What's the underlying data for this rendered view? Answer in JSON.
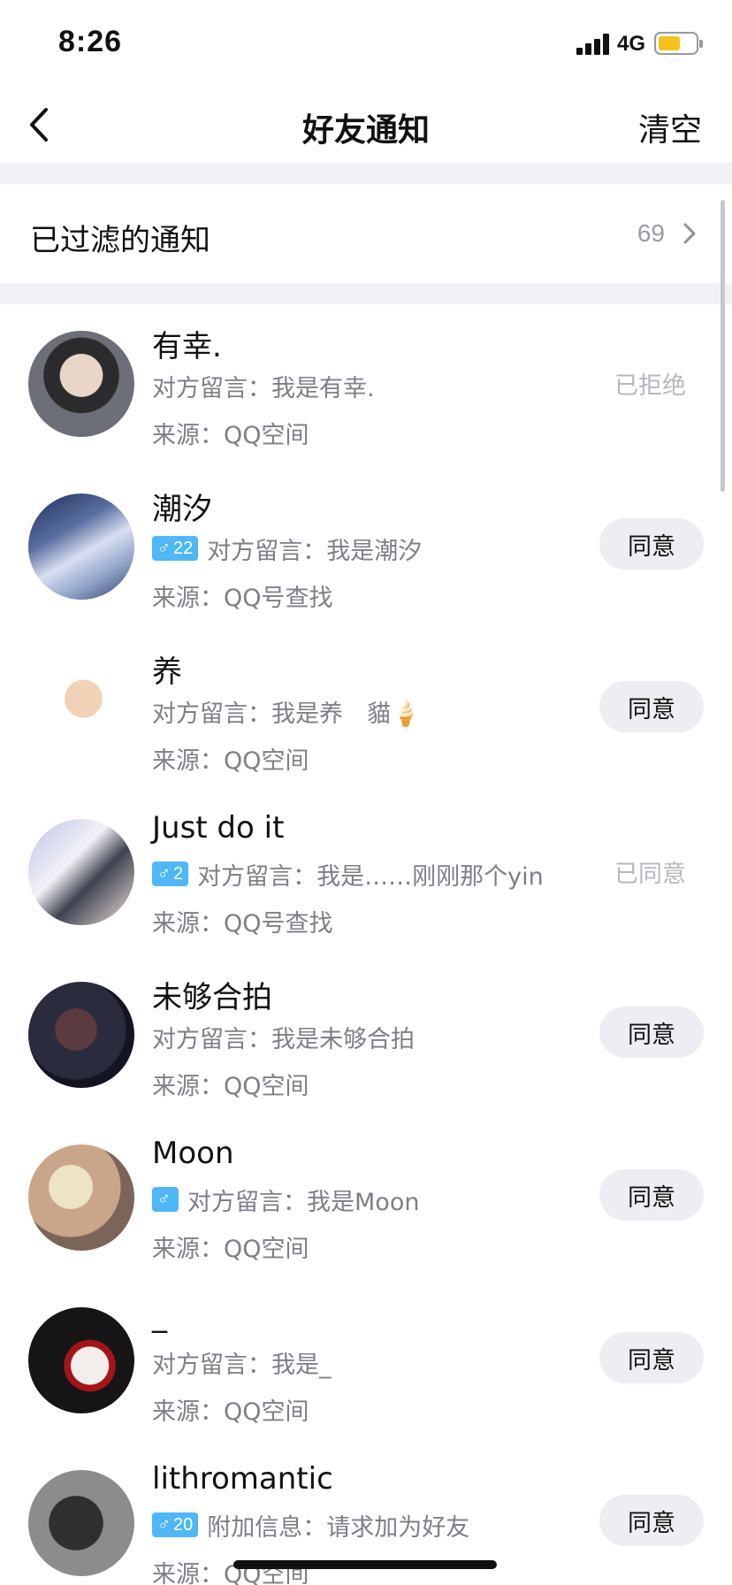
{
  "status_bar": {
    "time": "8:26",
    "network": "4G",
    "battery_color": "#f5c21b"
  },
  "nav": {
    "title": "好友通知",
    "clear_label": "清空",
    "back_icon": "chevron-left-icon"
  },
  "filtered": {
    "label": "已过滤的通知",
    "count": "69",
    "chevron_icon": "chevron-right-icon"
  },
  "colors": {
    "badge_male": "#4fb7f6",
    "secondary_text": "#7d7f88",
    "button_bg": "#edeef3",
    "gap_bg": "#f1f2f6"
  },
  "requests": [
    {
      "name": "有幸.",
      "badge": null,
      "message": "对方留言：我是有幸.",
      "source": "来源：QQ空间",
      "action": "已拒绝",
      "action_type": "status"
    },
    {
      "name": "潮汐",
      "badge": "22",
      "message": "对方留言：我是潮汐",
      "source": "来源：QQ号查找",
      "action": "同意",
      "action_type": "button"
    },
    {
      "name": "养",
      "badge": null,
      "message": "对方留言：我是养　貓🍦",
      "source": "来源：QQ空间",
      "action": "同意",
      "action_type": "button"
    },
    {
      "name": "Just do it",
      "badge": "2",
      "message": "对方留言：我是……刚刚那个yin",
      "source": "来源：QQ号查找",
      "action": "已同意",
      "action_type": "status"
    },
    {
      "name": "未够合拍",
      "badge": null,
      "message": "对方留言：我是未够合拍",
      "source": "来源：QQ空间",
      "action": "同意",
      "action_type": "button"
    },
    {
      "name": "Moon",
      "badge": "",
      "message": "对方留言：我是Moon",
      "source": "来源：QQ空间",
      "action": "同意",
      "action_type": "button"
    },
    {
      "name": "_",
      "badge": null,
      "message": "对方留言：我是_",
      "source": "来源：QQ空间",
      "action": "同意",
      "action_type": "button"
    },
    {
      "name": "lithromantic",
      "badge": "20",
      "message": "附加信息：请求加为好友",
      "source": "来源：QQ空间",
      "action": "同意",
      "action_type": "button"
    }
  ]
}
